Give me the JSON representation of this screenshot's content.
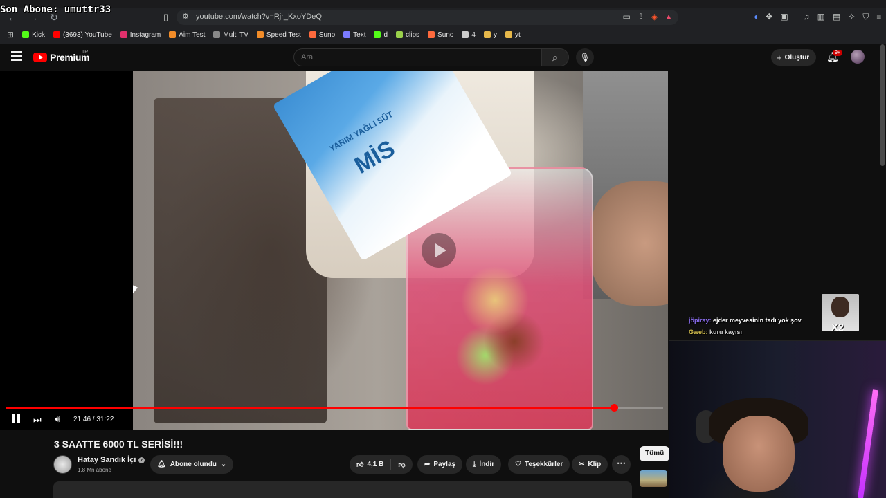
{
  "overlay": {
    "last_sub": "Son Abone: umuttr33"
  },
  "browser": {
    "url": "youtube.com/watch?v=Rjr_KxoYDeQ",
    "bookmarks": [
      {
        "label": "Kick",
        "color": "#53fc18"
      },
      {
        "label": "(3693) YouTube",
        "color": "#ff0000"
      },
      {
        "label": "Instagram",
        "color": "#e1306c"
      },
      {
        "label": "Aim Test",
        "color": "#f28c28"
      },
      {
        "label": "Multi TV",
        "color": "#888888"
      },
      {
        "label": "Speed Test",
        "color": "#f28c28"
      },
      {
        "label": "Suno",
        "color": "#ff6a3d"
      },
      {
        "label": "Text",
        "color": "#7b7bff"
      },
      {
        "label": "d",
        "color": "#53fc18"
      },
      {
        "label": "clips",
        "color": "#9ad14b"
      },
      {
        "label": "Suno",
        "color": "#ff6a3d"
      },
      {
        "label": "4",
        "color": "#cccccc"
      },
      {
        "label": "y",
        "color": "#e6b84a"
      },
      {
        "label": "yt",
        "color": "#e6b84a"
      }
    ]
  },
  "youtube": {
    "logo": "Premium",
    "region": "TR",
    "search_placeholder": "Ara",
    "create_label": "Oluştur",
    "notification_badge": "9+"
  },
  "video": {
    "carton_brand": "MİS",
    "carton_product": "YARIM YAĞLI SÜT",
    "time": "21:46 / 31:22",
    "progress": 0.925,
    "title": "3 SAATTE 6000 TL SERİSİ!!!",
    "channel": "Hatay Sandık İçi",
    "subscribers": "1,8 Mn abone",
    "subscribe_label": "Abone olundu",
    "likes": "4,1 B",
    "share_label": "Paylaş",
    "download_label": "İndir",
    "thanks_label": "Teşekkürler",
    "clip_label": "Klip",
    "filter_chip": "Tümü"
  },
  "chat": [
    {
      "user": "jöpiray:",
      "msg": "ejder meyvesinin tadı yok şov"
    },
    {
      "user": "Gweb:",
      "msg": "kuru kayısı"
    }
  ],
  "emote": {
    "label": "X2"
  }
}
